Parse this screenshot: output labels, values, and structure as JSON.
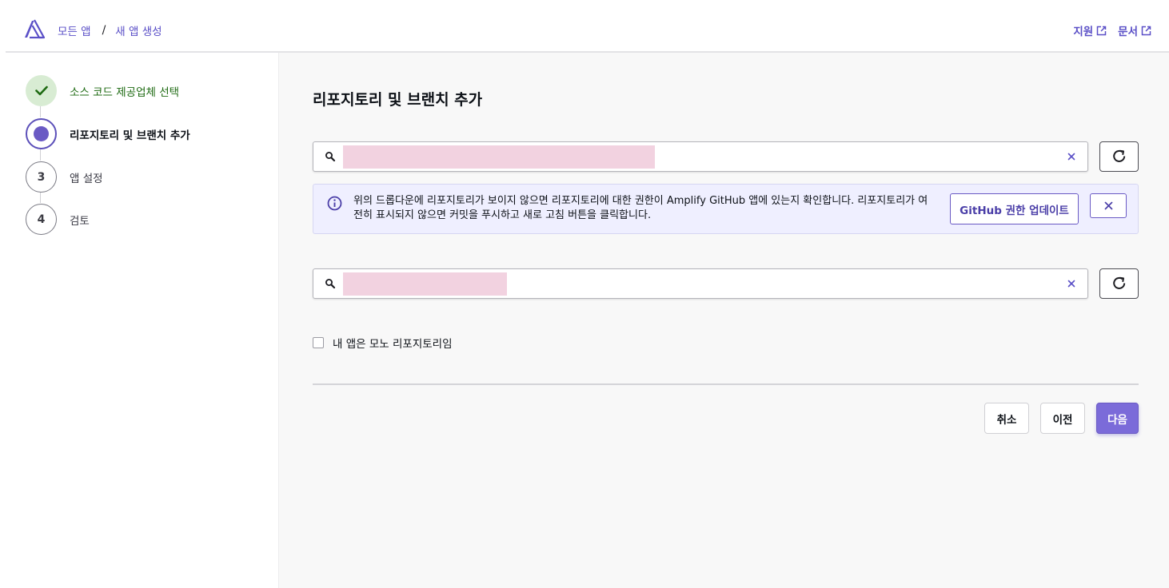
{
  "breadcrumb": {
    "items": [
      "모든 앱",
      "새 앱 생성"
    ],
    "separator": "/"
  },
  "top_links": {
    "support": "지원",
    "docs": "문서"
  },
  "sidebar": {
    "steps": [
      {
        "label": "소스 코드 제공업체 선택",
        "state": "done"
      },
      {
        "label": "리포지토리 및 브랜치 추가",
        "state": "current"
      },
      {
        "label": "앱 설정",
        "state": "todo",
        "number": "3"
      },
      {
        "label": "검토",
        "state": "todo",
        "number": "4"
      }
    ]
  },
  "main": {
    "title": "리포지토리 및 브랜치 추가",
    "repo_search": {
      "value": ""
    },
    "branch_search": {
      "value": ""
    },
    "alert": {
      "text": "위의 드롭다운에 리포지토리가 보이지 않으면 리포지토리에 대한 권한이 Amplify GitHub 앱에 있는지 확인합니다. 리포지토리가 여전히 표시되지 않으면 커밋을 푸시하고 새로 고침 버튼을 클릭합니다.",
      "button": "GitHub 권한 업데이트"
    },
    "monorepo_label": "내 앱은 모노 리포지토리임",
    "buttons": {
      "cancel": "취소",
      "previous": "이전",
      "next": "다음"
    }
  },
  "colors": {
    "accent": "#6a5ac4",
    "link": "#5a4fc7",
    "success": "#1e6a12",
    "redacted_field": "#f2d2e0"
  }
}
